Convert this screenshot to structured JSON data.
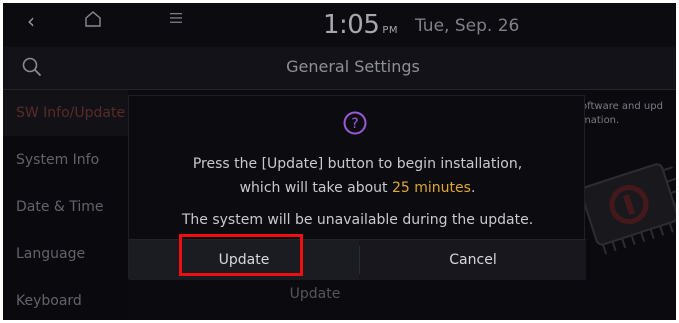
{
  "status_bar": {
    "back_icon": "chevron-left-icon",
    "home_icon": "home-icon",
    "menu_icon": "menu-icon",
    "time": "1:05",
    "ampm": "PM",
    "date": "Tue, Sep. 26"
  },
  "header": {
    "search_icon": "search-icon",
    "title": "General Settings"
  },
  "sidebar": {
    "items": [
      {
        "label": "SW Info/Update",
        "active": true
      },
      {
        "label": "System Info",
        "active": false
      },
      {
        "label": "Date & Time",
        "active": false
      },
      {
        "label": "Language",
        "active": false
      },
      {
        "label": "Keyboard",
        "active": false
      }
    ]
  },
  "main": {
    "description_line1": "oftware and upd",
    "description_line2": "mation.",
    "bottom_button_label": "Update"
  },
  "dialog": {
    "icon": "question-circle-icon",
    "line1": "Press the [Update] button to begin installation,",
    "line2_prefix": "which will take about ",
    "line2_highlight": "25 minutes",
    "line2_suffix": ".",
    "line3": "The system will be unavailable during the update.",
    "update_label": "Update",
    "cancel_label": "Cancel"
  },
  "colors": {
    "accent_purple": "#9b59d6",
    "highlight_orange": "#e3a72f",
    "annotation_red": "#ee1010"
  }
}
